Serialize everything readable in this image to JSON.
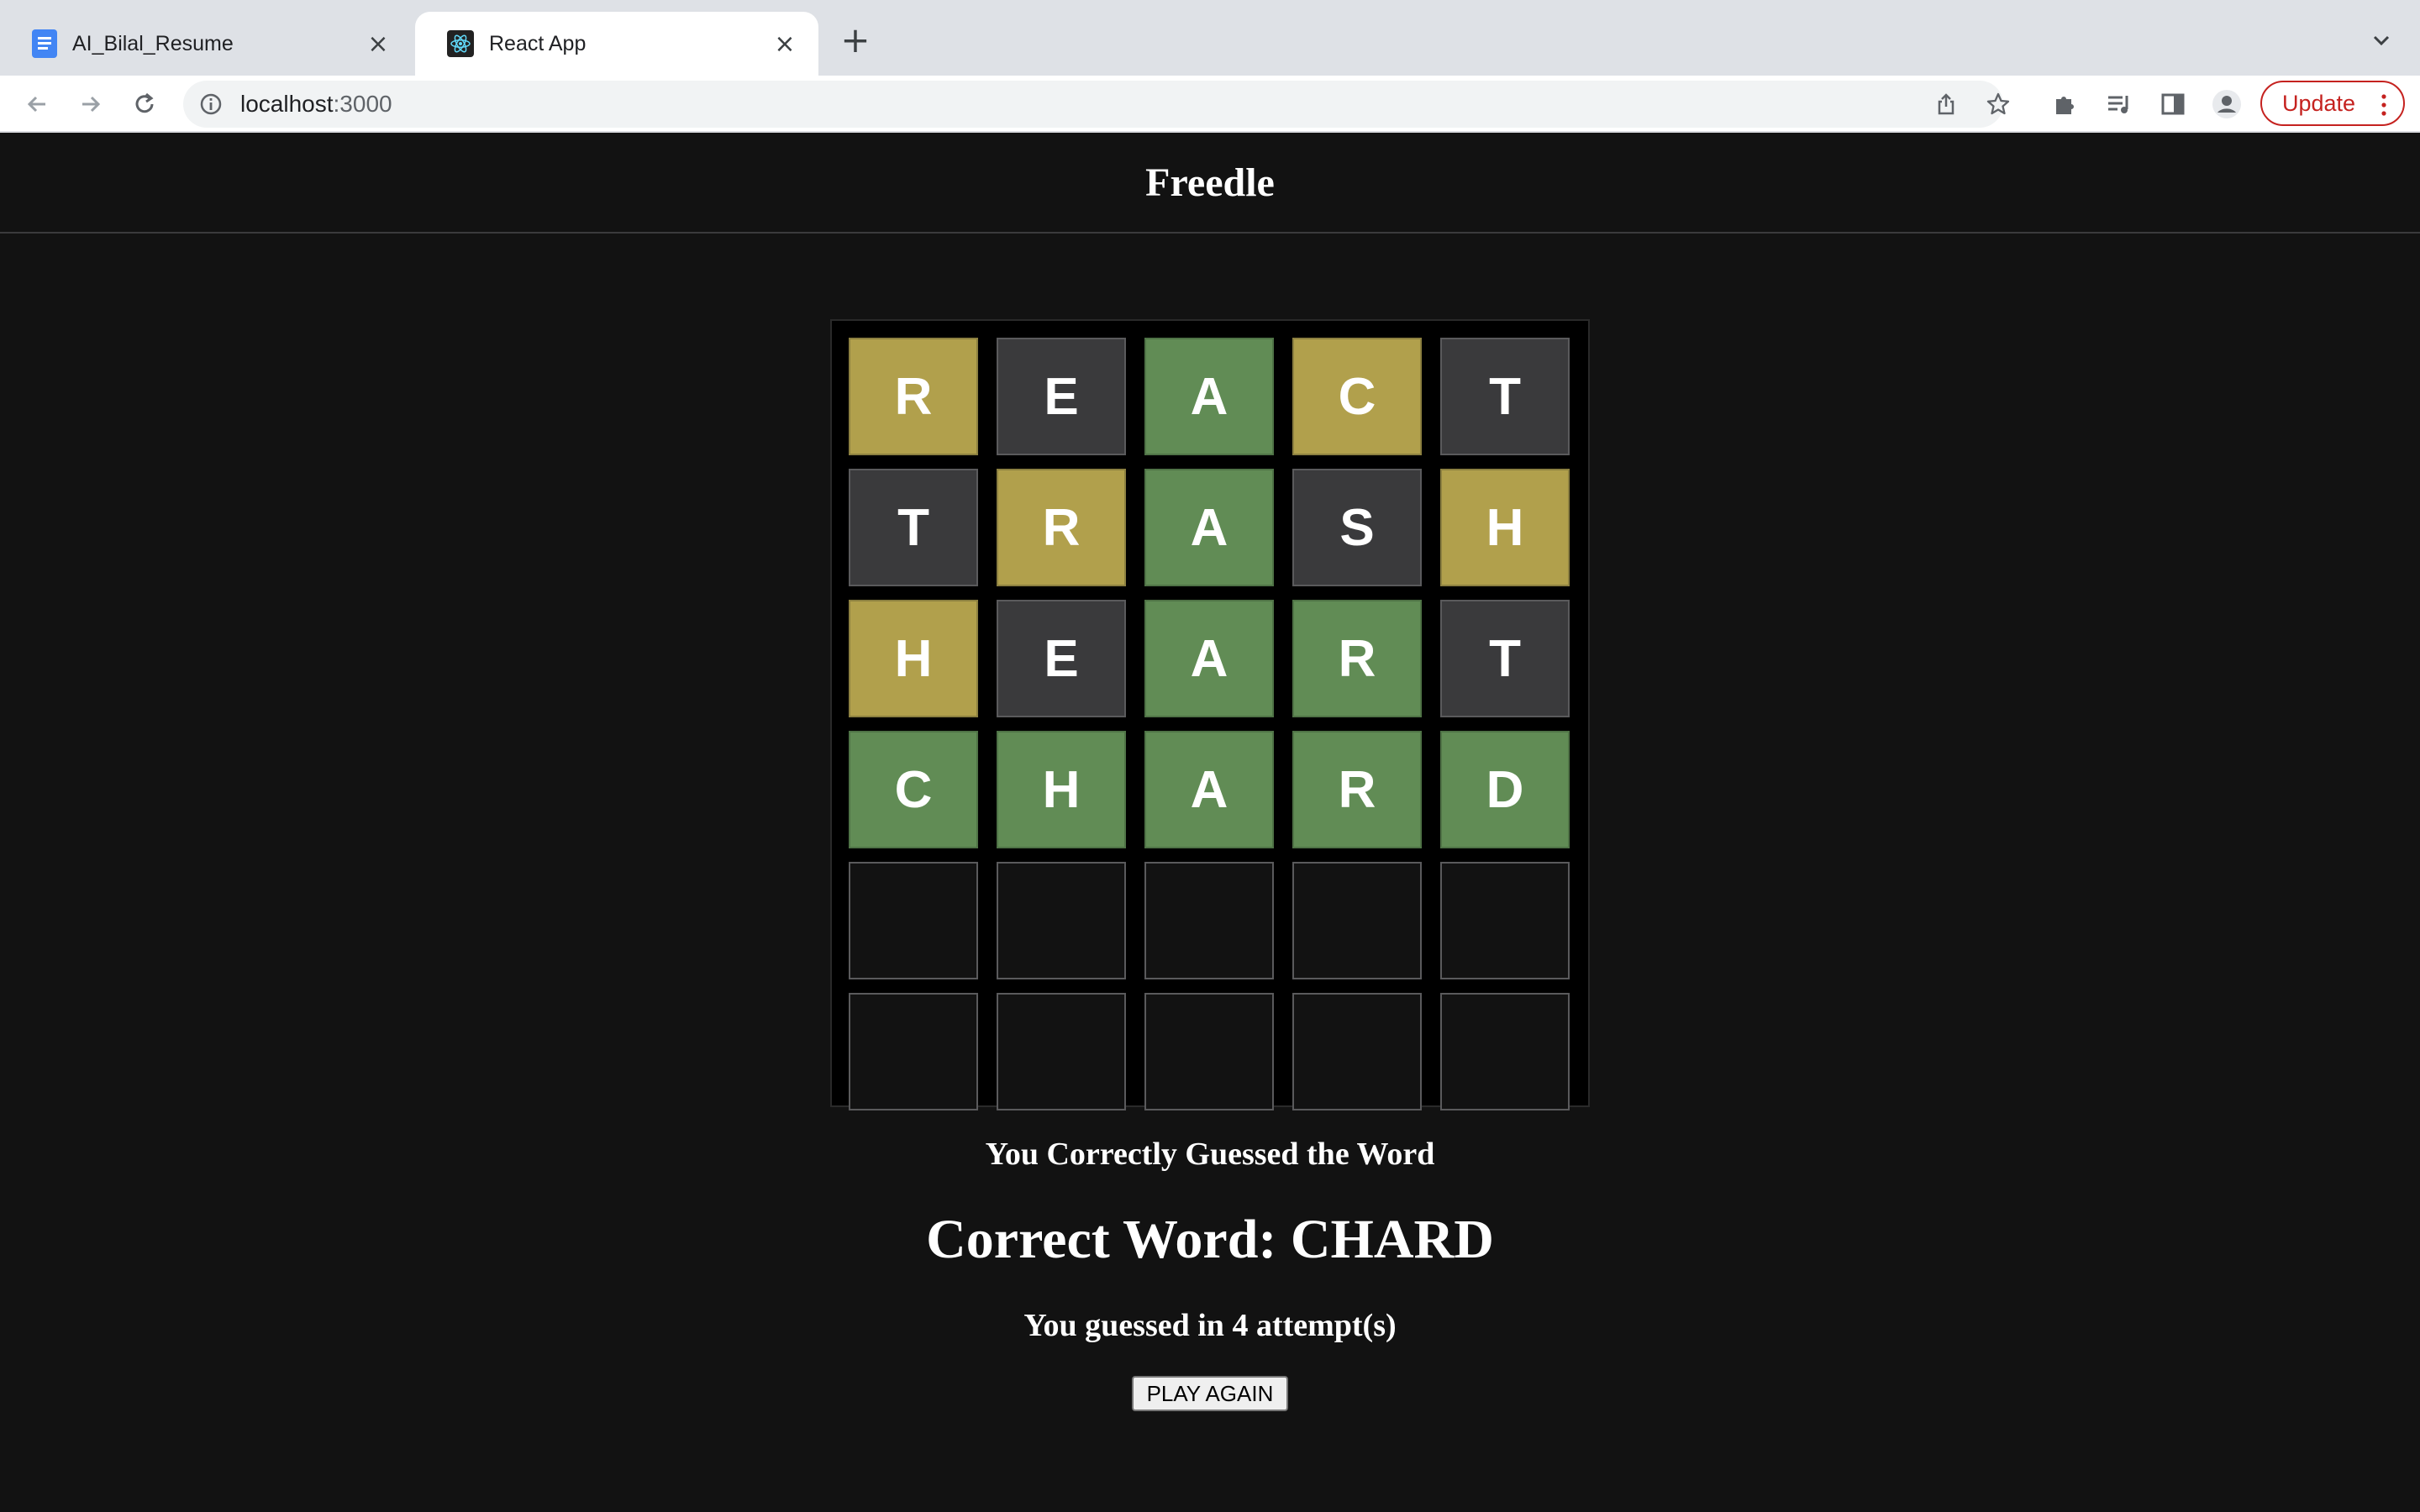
{
  "browser": {
    "tabs": [
      {
        "title": "AI_Bilal_Resume",
        "favicon": "google-docs-icon",
        "active": false
      },
      {
        "title": "React App",
        "favicon": "react-icon",
        "active": true
      }
    ],
    "url_host": "localhost",
    "url_port": ":3000",
    "update_label": "Update"
  },
  "app": {
    "title": "Freedle",
    "board": [
      [
        {
          "letter": "R",
          "state": "present"
        },
        {
          "letter": "E",
          "state": "absent"
        },
        {
          "letter": "A",
          "state": "correct"
        },
        {
          "letter": "C",
          "state": "present"
        },
        {
          "letter": "T",
          "state": "absent"
        }
      ],
      [
        {
          "letter": "T",
          "state": "absent"
        },
        {
          "letter": "R",
          "state": "present"
        },
        {
          "letter": "A",
          "state": "correct"
        },
        {
          "letter": "S",
          "state": "absent"
        },
        {
          "letter": "H",
          "state": "present"
        }
      ],
      [
        {
          "letter": "H",
          "state": "present"
        },
        {
          "letter": "E",
          "state": "absent"
        },
        {
          "letter": "A",
          "state": "correct"
        },
        {
          "letter": "R",
          "state": "correct"
        },
        {
          "letter": "T",
          "state": "absent"
        }
      ],
      [
        {
          "letter": "C",
          "state": "correct"
        },
        {
          "letter": "H",
          "state": "correct"
        },
        {
          "letter": "A",
          "state": "correct"
        },
        {
          "letter": "R",
          "state": "correct"
        },
        {
          "letter": "D",
          "state": "correct"
        }
      ],
      [
        {
          "letter": "",
          "state": "empty"
        },
        {
          "letter": "",
          "state": "empty"
        },
        {
          "letter": "",
          "state": "empty"
        },
        {
          "letter": "",
          "state": "empty"
        },
        {
          "letter": "",
          "state": "empty"
        }
      ],
      [
        {
          "letter": "",
          "state": "empty"
        },
        {
          "letter": "",
          "state": "empty"
        },
        {
          "letter": "",
          "state": "empty"
        },
        {
          "letter": "",
          "state": "empty"
        },
        {
          "letter": "",
          "state": "empty"
        }
      ]
    ],
    "result_message": "You Correctly Guessed the Word",
    "correct_word_text": "Correct Word: CHARD",
    "attempts_text": "You guessed in 4 attempt(s)",
    "play_again_label": "PLAY AGAIN"
  },
  "colors": {
    "present": "#b1a04c",
    "correct": "#618c55",
    "absent": "#3a3a3c",
    "background": "#121212"
  }
}
